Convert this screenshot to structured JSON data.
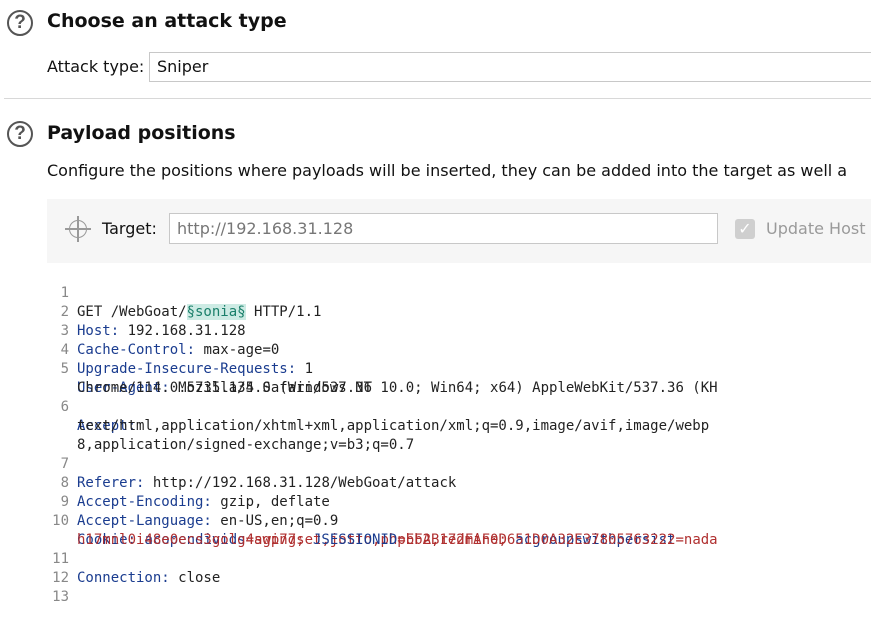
{
  "section1": {
    "title": "Choose an attack type",
    "help_icon": "help-icon"
  },
  "attack_type": {
    "label": "Attack type:",
    "value": "Sniper"
  },
  "section2": {
    "title": "Payload positions",
    "help_icon": "help-icon",
    "description": "Configure the positions where payloads will be inserted, they can be added into the target as well a"
  },
  "target": {
    "label": "Target:",
    "value": "http://192.168.31.128",
    "icon": "crosshair-icon"
  },
  "update_host": {
    "label": "Update Host",
    "checked": true
  },
  "request": {
    "line1": {
      "n": "1",
      "a": "GET /WebGoat/",
      "payload": "§sonia§",
      "b": " HTTP/1.1"
    },
    "line2": {
      "n": "2",
      "key": "Host:",
      "val": " 192.168.31.128"
    },
    "line3": {
      "n": "3",
      "key": "Cache-Control:",
      "val": " max-age=0"
    },
    "line4": {
      "n": "4",
      "key": "Upgrade-Insecure-Requests:",
      "val": " 1"
    },
    "line5": {
      "n": "5",
      "key": "User-Agent:",
      "val": " Mozilla/5.0 (Windows NT 10.0; Win64; x64) AppleWebKit/537.36 (KH"
    },
    "line5b": {
      "val": "Chrome/114.0.5735.134 Safari/537.36"
    },
    "line6": {
      "n": "6",
      "key": "Accept:"
    },
    "line6b": {
      "val": "text/html,application/xhtml+xml,application/xml;q=0.9,image/avif,image/webp"
    },
    "line6c": {
      "val": "8,application/signed-exchange;v=b3;q=0.7"
    },
    "line7": {
      "n": "7",
      "key": "Referer:",
      "val": " http://192.168.31.128/WebGoat/attack"
    },
    "line8": {
      "n": "8",
      "key": "Accept-Encoding:",
      "val": " gzip, deflate"
    },
    "line9": {
      "n": "9",
      "key": "Accept-Language:",
      "val": " en-US,en;q=0.9"
    },
    "line10": {
      "n": "10",
      "key": "Cookie:",
      "c1k": " acopendivids",
      "c1v": "=swingset,jotto,phpbb2,redmine;",
      "c2k": " acgroupswithpersist",
      "c2v": "=nada"
    },
    "line10b": {
      "c2v2": "h17mnl0i48e0ecs3golg4agp77;",
      "c3k": " JSESSIONID",
      "c3v": "=EFAB172FAF0D651D0A32E37805763222"
    },
    "line11": {
      "n": "11",
      "key": "Connection:",
      "val": " close"
    },
    "line12": {
      "n": "12"
    },
    "line13": {
      "n": "13"
    }
  }
}
